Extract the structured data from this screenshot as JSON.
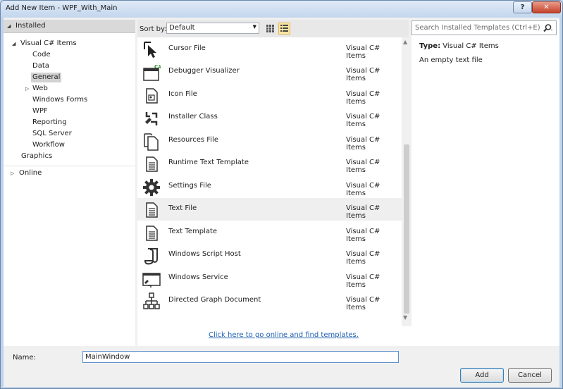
{
  "window": {
    "title": "Add New Item - WPF_With_Main",
    "help_label": "?",
    "close_label": "✕"
  },
  "tree": {
    "header": "Installed",
    "root": "Visual C# Items",
    "children": [
      "Code",
      "Data",
      "General",
      "Web",
      "Windows Forms",
      "WPF",
      "Reporting",
      "SQL Server",
      "Workflow"
    ],
    "selected": "General",
    "graphics": "Graphics",
    "online": "Online"
  },
  "toolbar": {
    "sort_label": "Sort by:",
    "sort_value": "Default"
  },
  "templates": [
    {
      "name": "Cursor File",
      "category": "Visual C# Items",
      "icon": "cursor-icon"
    },
    {
      "name": "Debugger Visualizer",
      "category": "Visual C# Items",
      "icon": "debugger-visualizer-icon"
    },
    {
      "name": "Icon File",
      "category": "Visual C# Items",
      "icon": "icon-file-icon"
    },
    {
      "name": "Installer Class",
      "category": "Visual C# Items",
      "icon": "installer-class-icon"
    },
    {
      "name": "Resources File",
      "category": "Visual C# Items",
      "icon": "resources-file-icon"
    },
    {
      "name": "Runtime Text Template",
      "category": "Visual C# Items",
      "icon": "text-document-icon"
    },
    {
      "name": "Settings File",
      "category": "Visual C# Items",
      "icon": "gear-icon"
    },
    {
      "name": "Text File",
      "category": "Visual C# Items",
      "icon": "text-document-icon"
    },
    {
      "name": "Text Template",
      "category": "Visual C# Items",
      "icon": "text-document-icon"
    },
    {
      "name": "Windows Script Host",
      "category": "Visual C# Items",
      "icon": "script-icon"
    },
    {
      "name": "Windows Service",
      "category": "Visual C# Items",
      "icon": "windows-service-icon"
    },
    {
      "name": "Directed Graph Document",
      "category": "Visual C# Items",
      "icon": "directed-graph-icon"
    }
  ],
  "highlighted_template": "Text File",
  "online_link": "Click here to go online and find templates.",
  "search": {
    "placeholder": "Search Installed Templates (Ctrl+E)"
  },
  "details": {
    "type_label": "Type:",
    "type_value": "Visual C# Items",
    "description": "An empty text file"
  },
  "name_field": {
    "label": "Name:",
    "value": "MainWindow"
  },
  "buttons": {
    "add": "Add",
    "cancel": "Cancel"
  },
  "colors": {
    "link": "#1f5fb3",
    "selection": "#d2d2d2",
    "title_gradient_top": "#dfeaf7"
  }
}
